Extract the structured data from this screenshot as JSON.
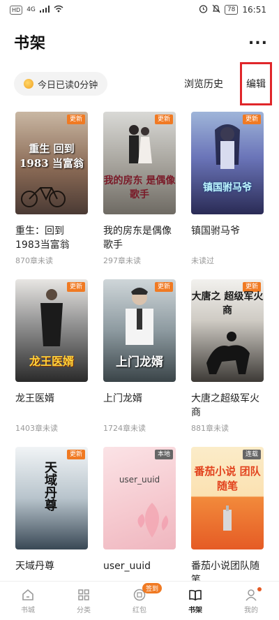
{
  "status_bar": {
    "left": {
      "hd": "HD",
      "signal": "4G",
      "wifi": "wifi"
    },
    "right": {
      "battery": "78",
      "time": "16:51"
    }
  },
  "header": {
    "title": "书架",
    "more": "..."
  },
  "toolbar": {
    "reading_time": "今日已读0分钟",
    "history": "浏览历史",
    "edit": "编辑"
  },
  "books": [
    {
      "title": "重生：回到1983当富翁",
      "progress": "870章未读",
      "badge": "更新",
      "cover_text": "重生 回到1983 当富翁"
    },
    {
      "title": "我的房东是偶像歌手",
      "progress": "297章未读",
      "badge": "更新",
      "cover_text": "我的房东 是偶像歌手"
    },
    {
      "title": "镇国驸马爷",
      "progress": "未读过",
      "badge": "更新",
      "cover_text": "镇国驸马爷"
    },
    {
      "title": "龙王医婿",
      "progress": "1403章未读",
      "badge": "更新",
      "cover_text": "龙王医婿"
    },
    {
      "title": "上门龙婿",
      "progress": "1724章未读",
      "badge": "更新",
      "cover_text": "上门龙婿"
    },
    {
      "title": "大唐之超级军火商",
      "progress": "881章未读",
      "badge": "更新",
      "cover_text": "大唐之 超级军火商"
    },
    {
      "title": "天域丹尊",
      "progress": "",
      "badge": "更新",
      "cover_text": "天域丹尊"
    },
    {
      "title": "user_uuid",
      "progress": "",
      "badge": "本地",
      "cover_text": "user_uuid"
    },
    {
      "title": "番茄小说团队随笔",
      "progress": "",
      "badge": "连载",
      "cover_text": "番茄小说 团队随笔"
    }
  ],
  "tabs": [
    {
      "label": "书城",
      "icon": "home-icon"
    },
    {
      "label": "分类",
      "icon": "grid-icon"
    },
    {
      "label": "红包",
      "icon": "redpacket-icon",
      "badge": "签到"
    },
    {
      "label": "书架",
      "icon": "book-icon",
      "active": true
    },
    {
      "label": "我的",
      "icon": "user-icon"
    }
  ],
  "colors": {
    "accent": "#f07a23",
    "highlight_box": "#e0262a"
  }
}
